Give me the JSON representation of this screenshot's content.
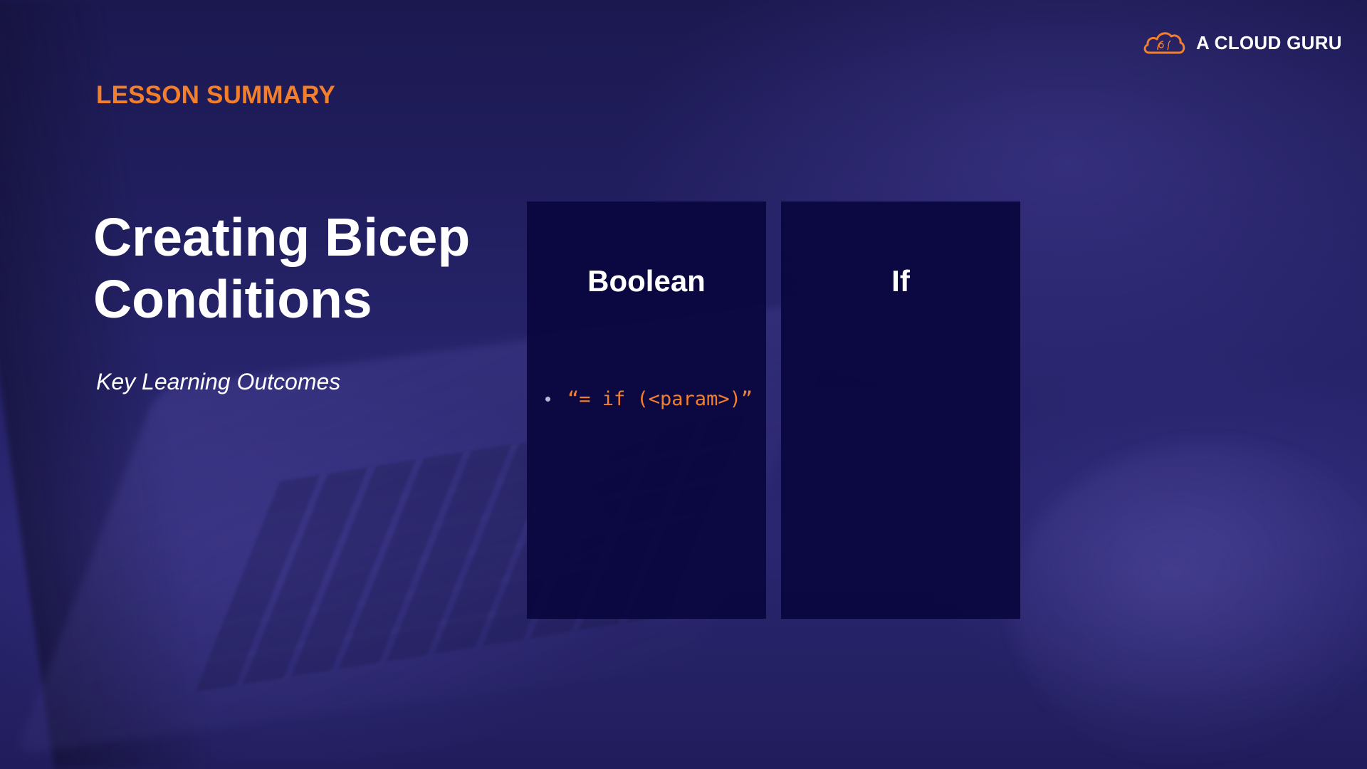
{
  "slide": {
    "eyebrow": "LESSON SUMMARY",
    "title_line1": "Creating Bicep",
    "title_line2": "Conditions",
    "subtitle": "Key Learning Outcomes"
  },
  "logo": {
    "icon": "cloud-icon",
    "text": "A CLOUD GURU"
  },
  "cards": [
    {
      "title": "Boolean",
      "bullets": [
        "“= if (<param>)”"
      ]
    },
    {
      "title": "If",
      "bullets": []
    }
  ],
  "colors": {
    "accent": "#f47f2a",
    "background": "#26236a",
    "card": "#0a063e",
    "text": "#ffffff"
  }
}
